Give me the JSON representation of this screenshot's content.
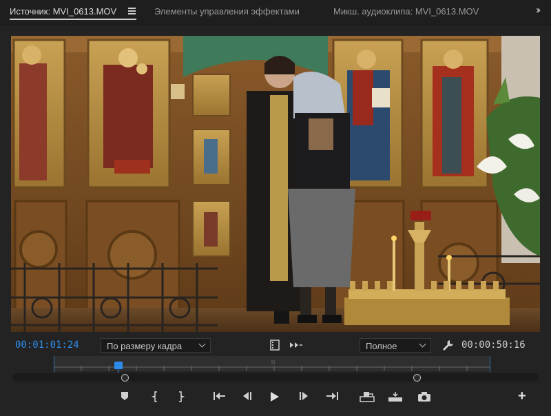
{
  "tabs": [
    {
      "label": "Источник: MVI_0613.MOV",
      "active": true
    },
    {
      "label": "Элементы управления эффектами",
      "active": false
    },
    {
      "label": "Микш. аудиоклипа: MVI_0613.MOV",
      "active": false
    }
  ],
  "controls": {
    "current_timecode": "00:01:01:24",
    "fit_label": "По размеру кадра",
    "resolution_label": "Полное",
    "duration_timecode": "00:00:50:16"
  },
  "colors": {
    "accent": "#2d8ceb",
    "panel_bg": "#232323"
  },
  "icons": [
    "panel-menu-icon",
    "overflow-chevrons-icon",
    "clip-icon",
    "insert-overwrite-icon",
    "settings-wrench-icon",
    "add-marker-icon",
    "mark-in-icon",
    "mark-out-icon",
    "go-to-in-icon",
    "step-back-icon",
    "play-icon",
    "step-forward-icon",
    "go-to-out-icon",
    "insert-icon",
    "overwrite-icon",
    "export-frame-icon",
    "button-editor-plus-icon"
  ]
}
